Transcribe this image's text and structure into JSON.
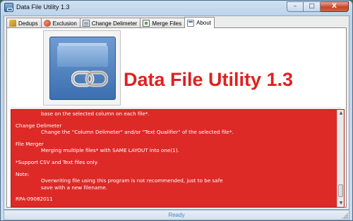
{
  "window": {
    "title": "Data File Utility 1.3",
    "min_label": "–",
    "max_label": "□",
    "close_label": "X"
  },
  "tabs": [
    {
      "label": "Dedups",
      "icon": "dedups-icon"
    },
    {
      "label": "Exclusion",
      "icon": "exclusion-icon"
    },
    {
      "label": "Change Delimeter",
      "icon": "delimeter-icon"
    },
    {
      "label": "Merge Files",
      "icon": "merge-icon"
    },
    {
      "label": "About",
      "icon": "about-icon",
      "active": true
    }
  ],
  "about": {
    "app_title": "Data File Utility 1.3",
    "lines": [
      {
        "text": "base on the selected column on each file*.",
        "indent": true
      },
      {
        "text": "",
        "gap": true
      },
      {
        "text": "Change Delimeter",
        "indent": false
      },
      {
        "text": "Change the \"Column Delimeter\" and/or \"Text Qualifier\" of the selected file*.",
        "indent": true
      },
      {
        "text": "",
        "gap": true
      },
      {
        "text": "File Merger",
        "indent": false
      },
      {
        "text": "Merging multiple files* with SAME LAYOUT into one(1).",
        "indent": true
      },
      {
        "text": "",
        "gap": true
      },
      {
        "text": "*Support CSV and Text files only.",
        "indent": false
      },
      {
        "text": "",
        "gap": true
      },
      {
        "text": "Note:",
        "indent": false
      },
      {
        "text": "Overwriting file using this program is not recommended, just to be safe",
        "indent": true
      },
      {
        "text": "save with a new filename.",
        "indent": true
      },
      {
        "text": "",
        "gap": true
      },
      {
        "text": "RPA-09082011",
        "indent": false
      }
    ]
  },
  "status": {
    "text": "Ready"
  },
  "colors": {
    "info_background": "#dd2a27",
    "title_red": "#e02020",
    "status_text": "#3a8fd6"
  }
}
